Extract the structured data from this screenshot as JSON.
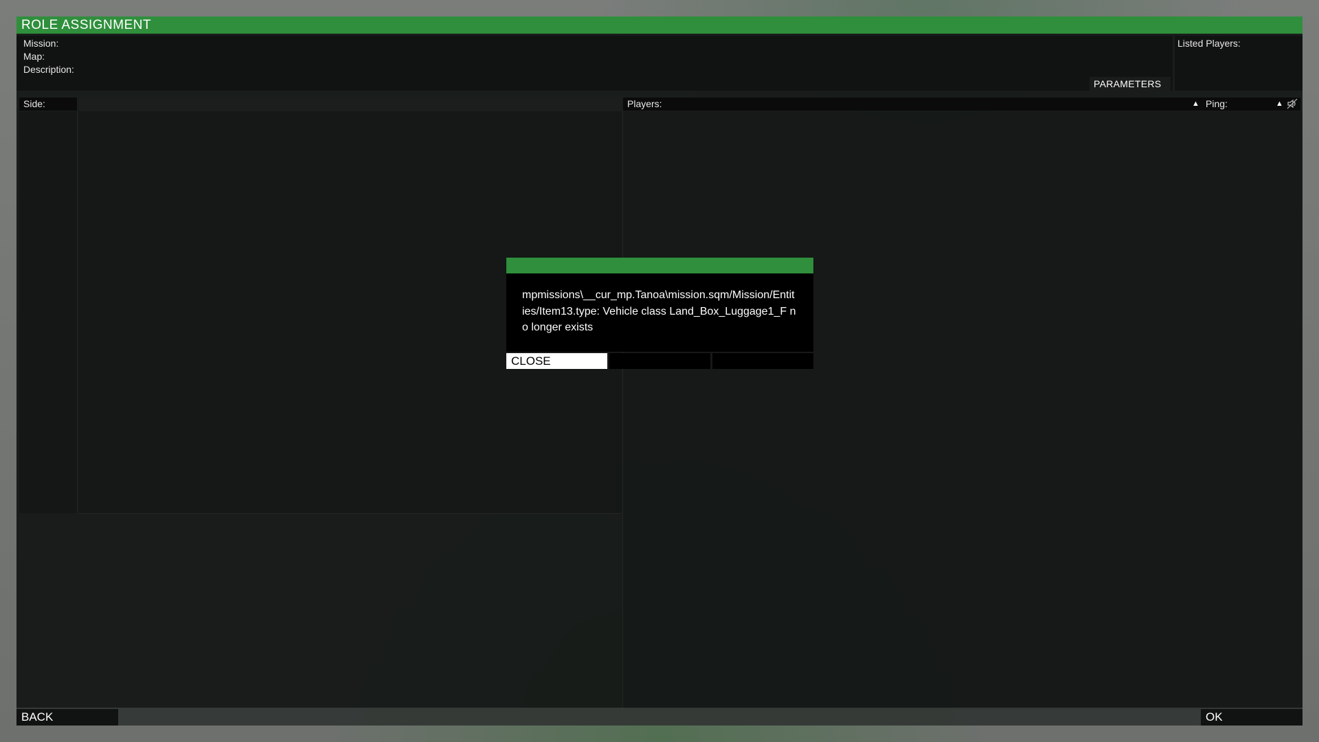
{
  "window": {
    "title": "ROLE ASSIGNMENT"
  },
  "info": {
    "mission_label": "Mission:",
    "map_label": "Map:",
    "description_label": "Description:",
    "listed_players_label": "Listed Players:",
    "parameters_button": "PARAMETERS"
  },
  "sides": {
    "header": "Side:"
  },
  "players": {
    "header": "Players:",
    "ping_header": "Ping:",
    "sort_icon": "triangle-up-icon",
    "mute_icon": "speaker-muted-icon"
  },
  "footer": {
    "back_label": "BACK",
    "ok_label": "OK"
  },
  "dialog": {
    "message": "mpmissions\\__cur_mp.Tanoa\\mission.sqm/Mission/Entities/Item13.type: Vehicle class Land_Box_Luggage1_F no longer exists",
    "close_label": "CLOSE"
  },
  "colors": {
    "accent": "#2f8f3c",
    "panel": "#111312",
    "text": "#ffffff"
  }
}
